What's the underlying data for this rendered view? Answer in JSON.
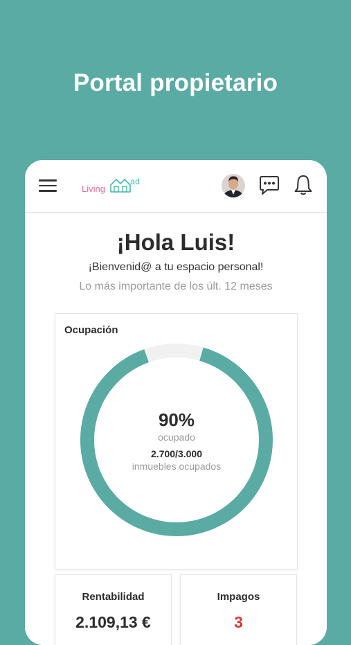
{
  "promo": {
    "title": "Portal propietario"
  },
  "header": {
    "logo_living": "Living",
    "logo_ad": "ad",
    "icons": [
      "menu-icon",
      "avatar",
      "chat-icon",
      "bell-icon"
    ]
  },
  "welcome": {
    "greeting": "¡Hola Luis!",
    "message": "¡Bienvenid@ a tu espacio personal!",
    "period": "Lo más importante de los últ. 12 meses"
  },
  "occupancy": {
    "title": "Ocupación",
    "percent_text": "90%",
    "percent_value": 90,
    "status_label": "ocupado",
    "count_text": "2.700/3.000",
    "count_label": "inmuebles ocupados",
    "fill_color": "#5aaba3",
    "track_color": "#f1f1f1"
  },
  "kpis": {
    "rentabilidad": {
      "title": "Rentabilidad",
      "value": "2.109,13 €"
    },
    "impagos": {
      "title": "Impagos",
      "value": "3",
      "value_color": "#d93a3a"
    }
  },
  "colors": {
    "background": "#5aaba3",
    "accent": "#5aaba3",
    "logo_pink": "#e8699a",
    "logo_teal": "#4fb5ad"
  }
}
